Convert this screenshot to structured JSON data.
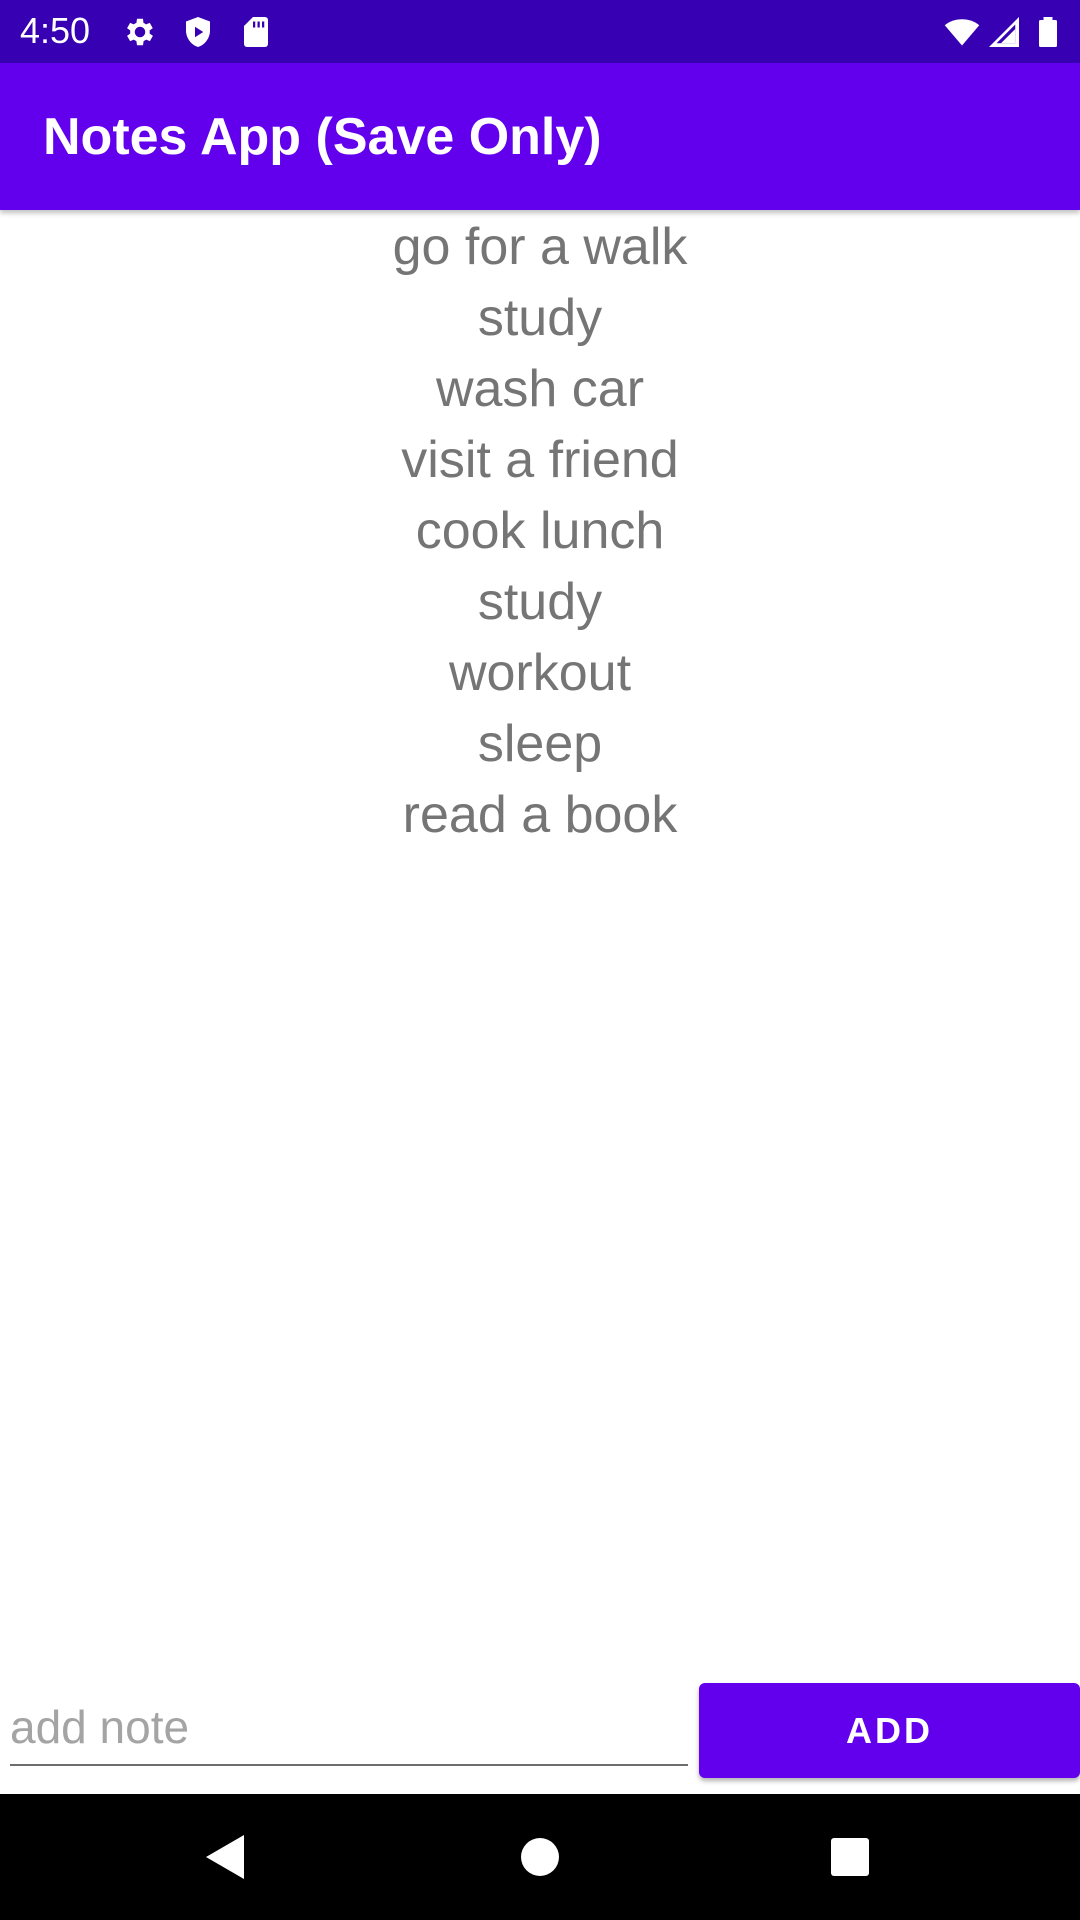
{
  "status_bar": {
    "time": "4:50",
    "icons": [
      "settings-icon",
      "shield-icon",
      "sd-card-icon",
      "wifi-icon",
      "signal-icon",
      "battery-icon"
    ]
  },
  "app_bar": {
    "title": "Notes App (Save Only)"
  },
  "notes": [
    "go for a walk",
    "study",
    "wash car",
    "visit a friend",
    "cook lunch",
    "study",
    "workout",
    "sleep",
    "read a book"
  ],
  "input": {
    "placeholder": "add note",
    "value": ""
  },
  "add_button": {
    "label": "ADD"
  },
  "nav_bar": {
    "icons": [
      "back-icon",
      "home-icon",
      "recents-icon"
    ]
  },
  "colors": {
    "status_bar": "#3700B3",
    "primary": "#6200EE",
    "note_text": "#757575",
    "nav_bar": "#000000"
  }
}
